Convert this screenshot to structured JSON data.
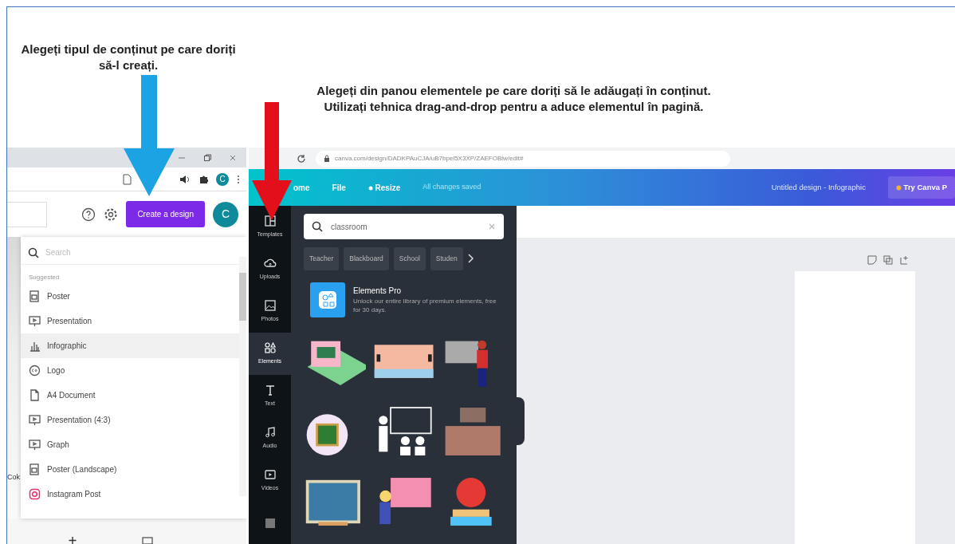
{
  "annotations": [
    {
      "lines": [
        "Alegeți tipul de conținut pe care doriți să-l creați."
      ],
      "color": "#1ba3e3"
    },
    {
      "lines": [
        "Alegeți din panou elementele pe care doriți să le adăugați în conținut.",
        "Utilizați tehnica drag-and-drop pentru a aduce elementul în pagină."
      ],
      "color": "#e3101c"
    }
  ],
  "left_screenshot": {
    "browser_avatar": "C",
    "create_button": "Create a design",
    "avatar": "C",
    "edge_text": "Cok",
    "dropdown": {
      "search_placeholder": "Search",
      "section": "Suggested",
      "items": [
        {
          "label": "Poster",
          "kind": "poster",
          "selected": false
        },
        {
          "label": "Presentation",
          "kind": "presentation",
          "selected": false
        },
        {
          "label": "Infographic",
          "kind": "infographic",
          "selected": true
        },
        {
          "label": "Logo",
          "kind": "logo",
          "selected": false
        },
        {
          "label": "A4 Document",
          "kind": "document",
          "selected": false
        },
        {
          "label": "Presentation (4:3)",
          "kind": "presentation",
          "selected": false
        },
        {
          "label": "Graph",
          "kind": "presentation",
          "selected": false
        },
        {
          "label": "Poster (Landscape)",
          "kind": "poster",
          "selected": false
        },
        {
          "label": "Instagram Post",
          "kind": "instagram",
          "selected": false
        }
      ]
    }
  },
  "right_screenshot": {
    "url": "canva.com/design/DADKPAuCJA/uB7bpel5X3XP/ZAEFOBlw/edit#",
    "menu": [
      "ome",
      "File",
      "Resize"
    ],
    "save_status": "All changes saved",
    "document_title": "Untitled design - Infographic",
    "upgrade_button": "Try Canva P",
    "sidebar": [
      {
        "label": "Templates",
        "kind": "templates",
        "selected": false
      },
      {
        "label": "Uploads",
        "kind": "uploads",
        "selected": false
      },
      {
        "label": "Photos",
        "kind": "photos",
        "selected": false
      },
      {
        "label": "Elements",
        "kind": "elements",
        "selected": true
      },
      {
        "label": "Text",
        "kind": "text",
        "selected": false
      },
      {
        "label": "Audio",
        "kind": "audio",
        "selected": false
      },
      {
        "label": "Videos",
        "kind": "videos",
        "selected": false
      }
    ],
    "search": {
      "value": "classroom"
    },
    "chips": [
      "Teacher",
      "Blackboard",
      "School",
      "Studen"
    ],
    "promo": {
      "title": "Elements Pro",
      "text": "Unlock our entire library of premium elements, free for 30 days."
    }
  }
}
